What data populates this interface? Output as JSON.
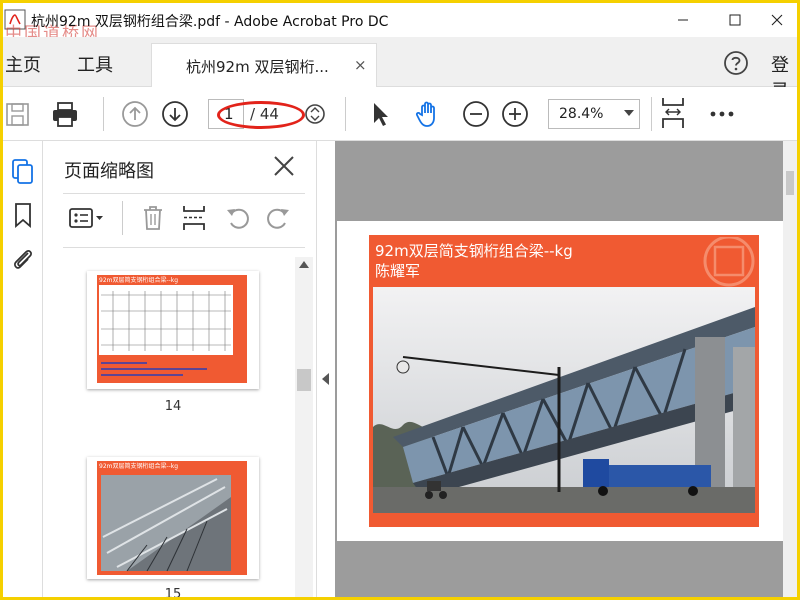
{
  "window": {
    "title": "杭州92m 双层钢桁组合梁.pdf - Adobe Acrobat Pro DC",
    "watermark": "中国道桥网"
  },
  "menubar": {
    "home": "主页",
    "tools": "工具",
    "tab_label": "杭州92m 双层钢桁...",
    "tab_close": "×",
    "login": "登录"
  },
  "toolbar": {
    "page_current": "1",
    "page_total": "/ 44",
    "zoom": "28.4%"
  },
  "thumbnail_panel": {
    "title": "页面缩略图",
    "thumbnails": [
      {
        "page": "14",
        "title": "92m双层简支钢桁组合梁--kg"
      },
      {
        "page": "15",
        "title": "92m双层简支钢桁组合梁--kg"
      }
    ]
  },
  "document": {
    "slide_title": "92m双层简支钢桁组合梁--kg",
    "slide_author": "陈耀军"
  },
  "colors": {
    "accent_red": "#e2231a",
    "slide_orange": "#f05a32",
    "frame_yellow": "#f5d000",
    "acrobat_blue": "#1473e6"
  }
}
